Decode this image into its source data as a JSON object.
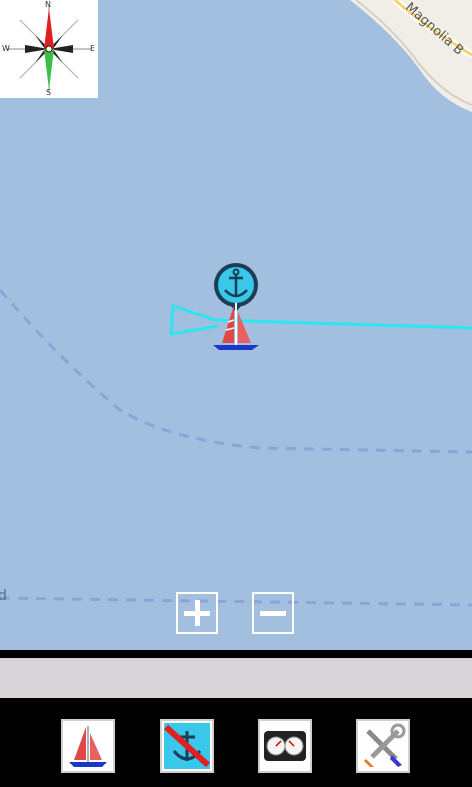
{
  "map": {
    "street_label": "Magnolia B",
    "edge_label": "d",
    "colors": {
      "water": "#a3bfdf",
      "land": "#f1eee7",
      "track": "#2ae6f0",
      "anchor": "#39c7ea"
    }
  },
  "compass": {
    "north": "N",
    "south": "S",
    "east": "E",
    "west": "W",
    "icon": "compass-rose-icon"
  },
  "markers": {
    "anchor_icon": "anchor-pin-icon",
    "boat_icon": "sailboat-icon"
  },
  "zoom": {
    "in_icon": "plus-icon",
    "out_icon": "minus-icon"
  },
  "toolbar": {
    "items": [
      {
        "name": "boat-button",
        "icon": "sailboat-icon"
      },
      {
        "name": "anchor-alarm-button",
        "icon": "anchor-off-icon"
      },
      {
        "name": "instruments-button",
        "icon": "gauges-icon"
      },
      {
        "name": "settings-button",
        "icon": "tools-icon"
      }
    ]
  }
}
